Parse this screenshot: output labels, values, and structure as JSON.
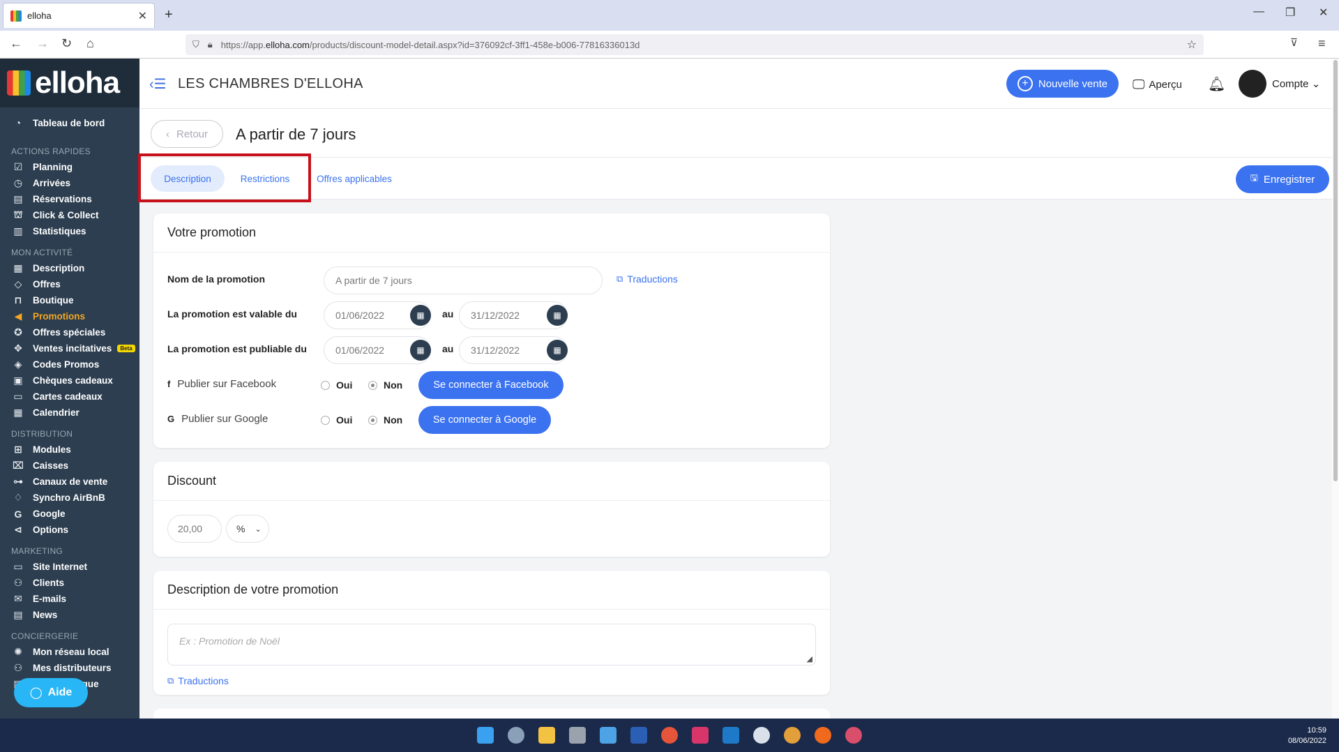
{
  "browser": {
    "tab_title": "elloha",
    "url_prefix": "https://app.",
    "url_host": "elloha.com",
    "url_path": "/products/discount-model-detail.aspx?id=376092cf-3ff1-458e-b006-77816336013d"
  },
  "sidebar": {
    "logo": "elloha",
    "dashboard": "Tableau de bord",
    "sections": [
      {
        "title": "ACTIONS RAPIDES",
        "items": [
          "Planning",
          "Arrivées",
          "Réservations",
          "Click & Collect",
          "Statistiques"
        ]
      },
      {
        "title": "MON ACTIVITÉ",
        "items": [
          "Description",
          "Offres",
          "Boutique",
          "Promotions",
          "Offres spéciales",
          "Ventes incitatives",
          "Codes Promos",
          "Chèques cadeaux",
          "Cartes cadeaux",
          "Calendrier"
        ]
      },
      {
        "title": "DISTRIBUTION",
        "items": [
          "Modules",
          "Caisses",
          "Canaux de vente",
          "Synchro AirBnB",
          "Google",
          "Options"
        ]
      },
      {
        "title": "MARKETING",
        "items": [
          "Site Internet",
          "Clients",
          "E-mails",
          "News"
        ]
      },
      {
        "title": "CONCIERGERIE",
        "items": [
          "Mon réseau local",
          "Mes distributeurs",
          "Mon catalogue"
        ]
      }
    ],
    "beta_badge": "Beta",
    "help_button": "Aide"
  },
  "header": {
    "hotel_name": "LES CHAMBRES D'ELLOHA",
    "new_sale": "Nouvelle vente",
    "preview": "Aperçu",
    "account": "Compte"
  },
  "page": {
    "back": "Retour",
    "title": "A partir de 7 jours",
    "tabs": [
      "Description",
      "Restrictions",
      "Offres applicables"
    ],
    "save": "Enregistrer"
  },
  "promo_card": {
    "title": "Votre promotion",
    "name_label": "Nom de la promotion",
    "name_value": "A partir de 7 jours",
    "translations": "Traductions",
    "valid_label": "La promotion est valable du",
    "valid_from": "01/06/2022",
    "valid_to": "31/12/2022",
    "publish_label": "La promotion est publiable du",
    "publish_from": "01/06/2022",
    "publish_to": "31/12/2022",
    "au": "au",
    "facebook_label": "Publier sur Facebook",
    "google_label": "Publier sur Google",
    "oui": "Oui",
    "non": "Non",
    "facebook_btn": "Se connecter à Facebook",
    "google_btn": "Se connecter à Google"
  },
  "discount_card": {
    "title": "Discount",
    "value": "20,00",
    "unit": "%"
  },
  "desc_card": {
    "title": "Description de votre promotion",
    "placeholder": "Ex : Promotion de Noël",
    "translations": "Traductions"
  },
  "taskbar": {
    "time": "10:59",
    "date": "08/06/2022"
  },
  "colors": {
    "accent": "#3b72f0",
    "sidebar": "#2c3e50",
    "active_menu": "#f5a623",
    "highlight_box": "#c8101a"
  }
}
